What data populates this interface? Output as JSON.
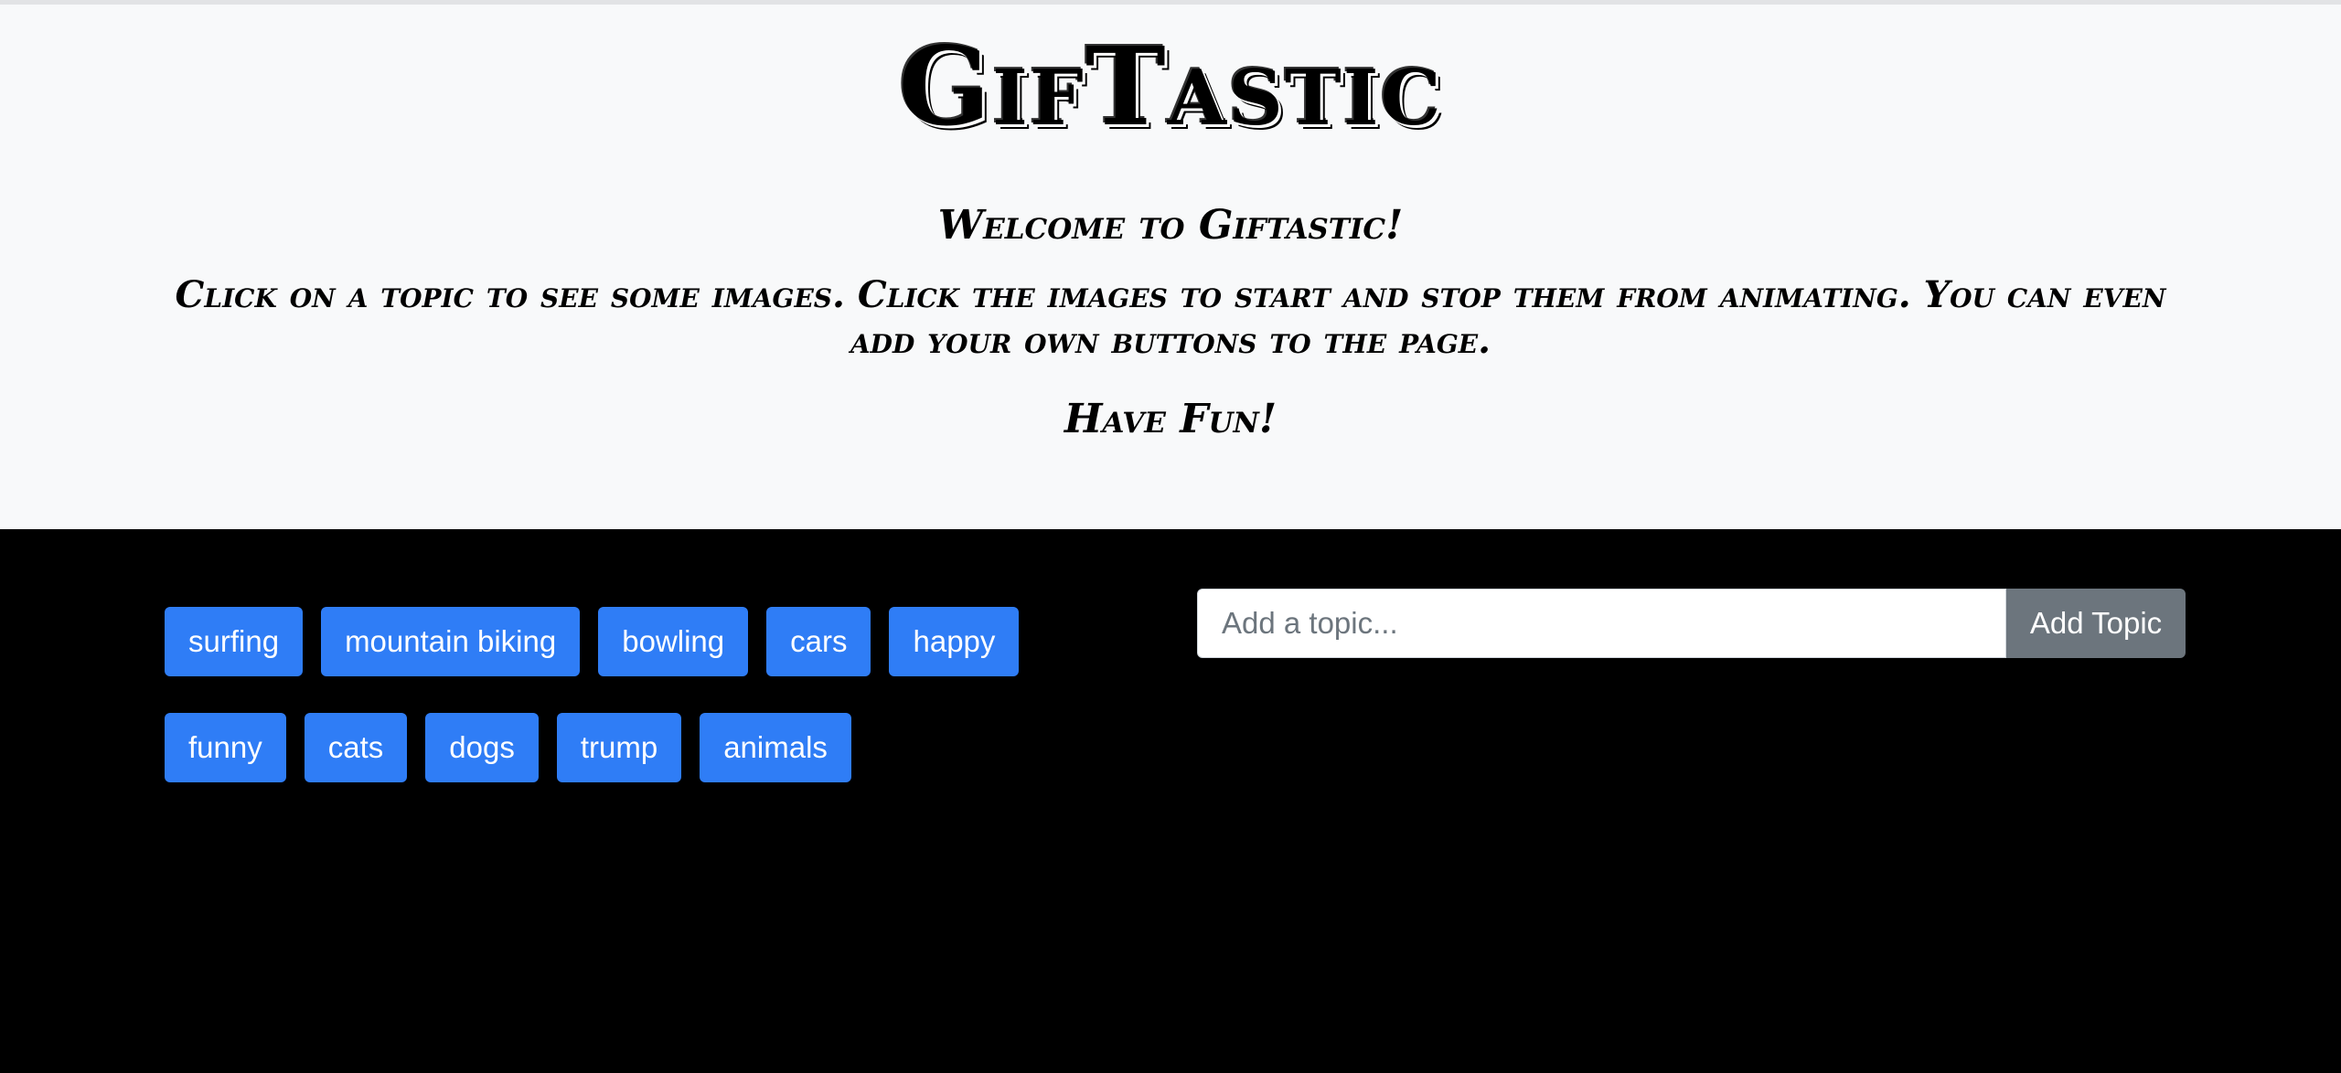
{
  "header": {
    "title": "GifTastic",
    "welcome": "Welcome to Giftastic!",
    "instructions": "Click on a topic to see some images. Click the images to start and stop them from animating. You can even add your own buttons to the page.",
    "closing": "Have Fun!"
  },
  "topics": {
    "row1": [
      "surfing",
      "mountain biking",
      "bowling",
      "cars",
      "happy"
    ],
    "row2": [
      "funny",
      "cats",
      "dogs",
      "trump",
      "animals"
    ]
  },
  "form": {
    "placeholder": "Add a topic...",
    "value": "",
    "submit_label": "Add Topic"
  },
  "colors": {
    "topic_button": "#2f7df6",
    "submit_button": "#6c757d",
    "jumbotron_bg": "#f8f9fa",
    "page_bg": "#000000"
  }
}
